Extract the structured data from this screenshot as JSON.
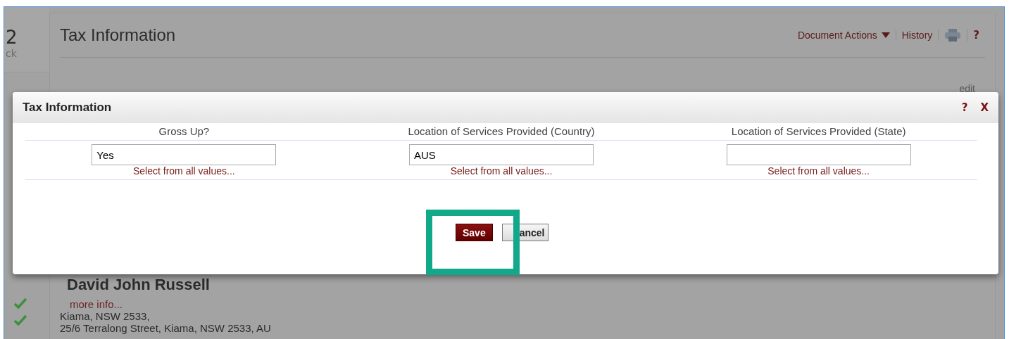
{
  "sidebar": {
    "number": "2",
    "caption": "ck"
  },
  "page": {
    "title": "Tax Information",
    "actions": [
      {
        "kind": "dropdown",
        "label": "Document Actions"
      },
      {
        "kind": "link",
        "label": "History"
      },
      {
        "kind": "print"
      },
      {
        "kind": "help",
        "label": "?"
      }
    ],
    "edit_link": "edit"
  },
  "contact": {
    "name": "David John Russell",
    "more": "more info...",
    "lines": [
      {
        "text": "Kiama, NSW 2533,",
        "checked": true
      },
      {
        "text": "25/6 Terralong Street, Kiama, NSW 2533, AU",
        "checked": true
      }
    ]
  },
  "dialog": {
    "title": "Tax Information",
    "help": "?",
    "close": "X",
    "fields": [
      {
        "label": "Gross Up?",
        "value": "Yes",
        "link": "Select from all values..."
      },
      {
        "label": "Location of Services Provided (Country)",
        "value": "AUS",
        "link": "Select from all values..."
      },
      {
        "label": "Location of Services Provided (State)",
        "link": "Select from all values..."
      }
    ],
    "buttons": [
      {
        "kind": "primary",
        "label": "Save"
      },
      {
        "kind": "secondary",
        "label": "ancel"
      }
    ]
  },
  "highlight": {
    "on": true
  }
}
